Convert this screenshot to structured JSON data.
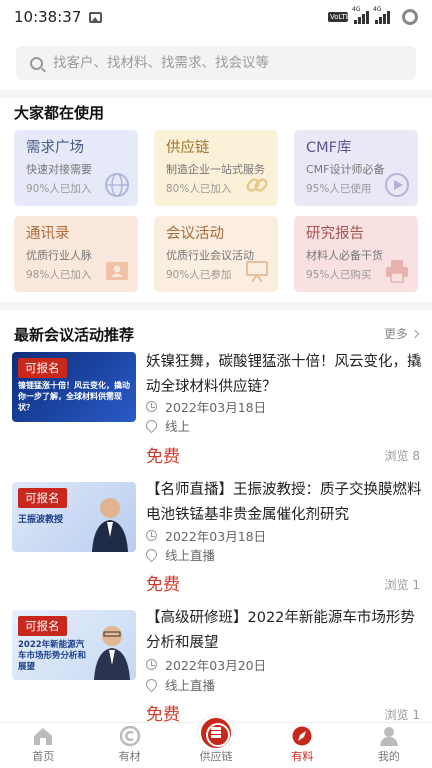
{
  "status_bar": {
    "time": "10:38:37",
    "volte_label": "VoLTE",
    "signal1": "4G",
    "signal2": "4G"
  },
  "search": {
    "placeholder": "找客户、找材料、找需求、找会议等"
  },
  "popular": {
    "title": "大家都在使用",
    "cards": [
      {
        "title": "需求广场",
        "subtitle": "快速对接需要",
        "count": "90%人已加入",
        "icon": "globe-icon",
        "color": "#e6eaf8"
      },
      {
        "title": "供应链",
        "subtitle": "制造企业一站式服务",
        "count": "80%人已加入",
        "icon": "link-icon",
        "color": "#fbf0d8"
      },
      {
        "title": "CMF库",
        "subtitle": "CMF设计师必备",
        "count": "95%人已使用",
        "icon": "play-icon",
        "color": "#ebe7f7"
      },
      {
        "title": "通讯录",
        "subtitle": "优质行业人脉",
        "count": "98%人已加入",
        "icon": "contact-card-icon",
        "color": "#fbe8dc"
      },
      {
        "title": "会议活动",
        "subtitle": "优质行业会议活动",
        "count": "90%人已参加",
        "icon": "presentation-icon",
        "color": "#fbeee0"
      },
      {
        "title": "研究报告",
        "subtitle": "材料人必备干货",
        "count": "95%人已购买",
        "icon": "printer-icon",
        "color": "#f9e1e1"
      }
    ]
  },
  "events": {
    "title": "最新会议活动推荐",
    "more_label": "更多",
    "items": [
      {
        "badge": "可报名",
        "title": "妖镍狂舞，碳酸锂猛涨十倍！风云变化，撬动全球材料供应链？",
        "date": "2022年03月18日",
        "location": "线上",
        "price": "免费",
        "views": "浏览 8",
        "thumb_text": "镍锂猛涨十倍！风云变化，撬动你一步了解，全球材料供需现状？"
      },
      {
        "badge": "可报名",
        "title": "【名师直播】王振波教授：质子交换膜燃料电池铁锰基非贵金属催化剂研究",
        "date": "2022年03月18日",
        "location": "线上直播",
        "price": "免费",
        "views": "浏览 1",
        "thumb_text": "王振波教授"
      },
      {
        "badge": "可报名",
        "title": "【高级研修班】2022年新能源车市场形势分析和展望",
        "date": "2022年03月20日",
        "location": "线上直播",
        "price": "免费",
        "views": "浏览 1",
        "thumb_text": "2022年新能源汽车市场形势分析和展望"
      }
    ]
  },
  "bottom_nav": [
    {
      "label": "首页",
      "icon": "home-icon",
      "active": false
    },
    {
      "label": "有材",
      "icon": "material-icon",
      "active": false
    },
    {
      "label": "供应链",
      "icon": "supply-chain-icon",
      "active": false
    },
    {
      "label": "有料",
      "icon": "compass-icon",
      "active": true
    },
    {
      "label": "我的",
      "icon": "person-icon",
      "active": false
    }
  ],
  "colors": {
    "accent": "#c8271c",
    "price": "#d23a2a"
  }
}
